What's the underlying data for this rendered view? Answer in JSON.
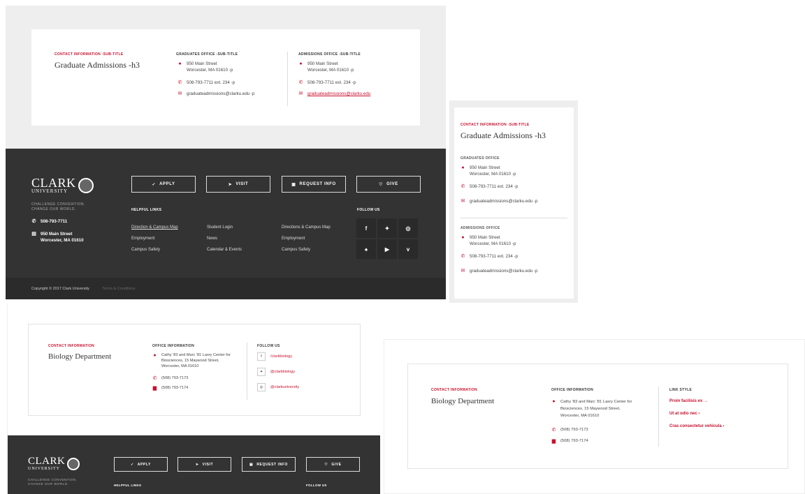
{
  "panel1": {
    "contact_sub": "CONTACT INFORMATION -SUB-TITLE",
    "title": "Graduate Admissions -h3",
    "grad_sub": "GRADUATES OFFICE -SUB-TITLE",
    "adm_sub": "ADMISSIONS OFFICE -SUB-TITLE",
    "addr1": "950 Main Street",
    "addr2": "Worcester, MA 01610 -p",
    "phone": "508-793-7711 ext. 234 -p",
    "email": "graduateadmissions@clarku.edu -p",
    "email_link": "graduateadmissions@clarku.edu"
  },
  "footer": {
    "logo_top": "CLARK",
    "logo_bottom": "UNIVERSITY",
    "tagline1": "CHALLENGE CONVENTION.",
    "tagline2": "CHANGE OUR WORLD.",
    "phone": "508-793-7711",
    "address1": "950 Main Street",
    "address2": "Worcester, MA 01610",
    "buttons": [
      "APPLY",
      "VISIT",
      "REQUEST INFO",
      "GIVE"
    ],
    "helpful_links": "HELPFUL LINKS",
    "follow_us": "FOLLOW US",
    "links": [
      [
        "Direction & Campus Map",
        "Student Login",
        "Directions & Campus Map"
      ],
      [
        "Employment",
        "News",
        "Employment"
      ],
      [
        "Campus Safety",
        "Calendar & Events",
        "Campus Safety"
      ]
    ],
    "copyright": "Copyright © 2017 Clark University",
    "terms": "Terms & Conditions"
  },
  "panel2": {
    "contact_sub": "CONTACT INFORMATION -SUB-TITLE",
    "title": "Graduate Admissions -h3",
    "grad_sub": "GRADUATES OFFICE",
    "adm_sub": "ADMISSIONS OFFICE",
    "addr1": "950 Main Street",
    "addr2": "Worcester, MA 01610 -p",
    "phone": "508-793-7711 ext. 234 -p",
    "email": "graduateadmissions@clarku.edu -p"
  },
  "panel3": {
    "contact_sub": "CONTACT INFORMATION",
    "title": "Biology Department",
    "office_sub": "OFFICE INFORMATION",
    "follow_sub": "FOLLOW US",
    "addr1": "Cathy '83 and Marc '81 Lasry Center for",
    "addr2": "Biosciences, 15 Maywood Street,",
    "addr3": "Worcester, MA 01610",
    "phone": "(508) 793-7173",
    "fax": "(508) 793-7174",
    "socials": [
      "/clarkbiology",
      "@clarkbiology",
      "@clarkuniversity"
    ]
  },
  "panel4": {
    "contact_sub": "CONTACT INFORMATION",
    "title": "Biology Department",
    "office_sub": "OFFICE INFORMATION",
    "link_sub": "LINK STYLE",
    "addr1": "Cathy '83 and Marc '81 Lasry Center for",
    "addr2": "Biosciences, 15 Maywood Street,",
    "addr3": "Worcester, MA 01610",
    "phone": "(508) 793-7173",
    "fax": "(508) 793-7174",
    "links": [
      "Proin facilisis ex →",
      "Ut at odio nec  ›",
      "Cras consectetur vehicula  ›"
    ]
  },
  "colors": {
    "accent": "#c8102e",
    "footer": "#333333",
    "bg": "#eeeeee"
  }
}
